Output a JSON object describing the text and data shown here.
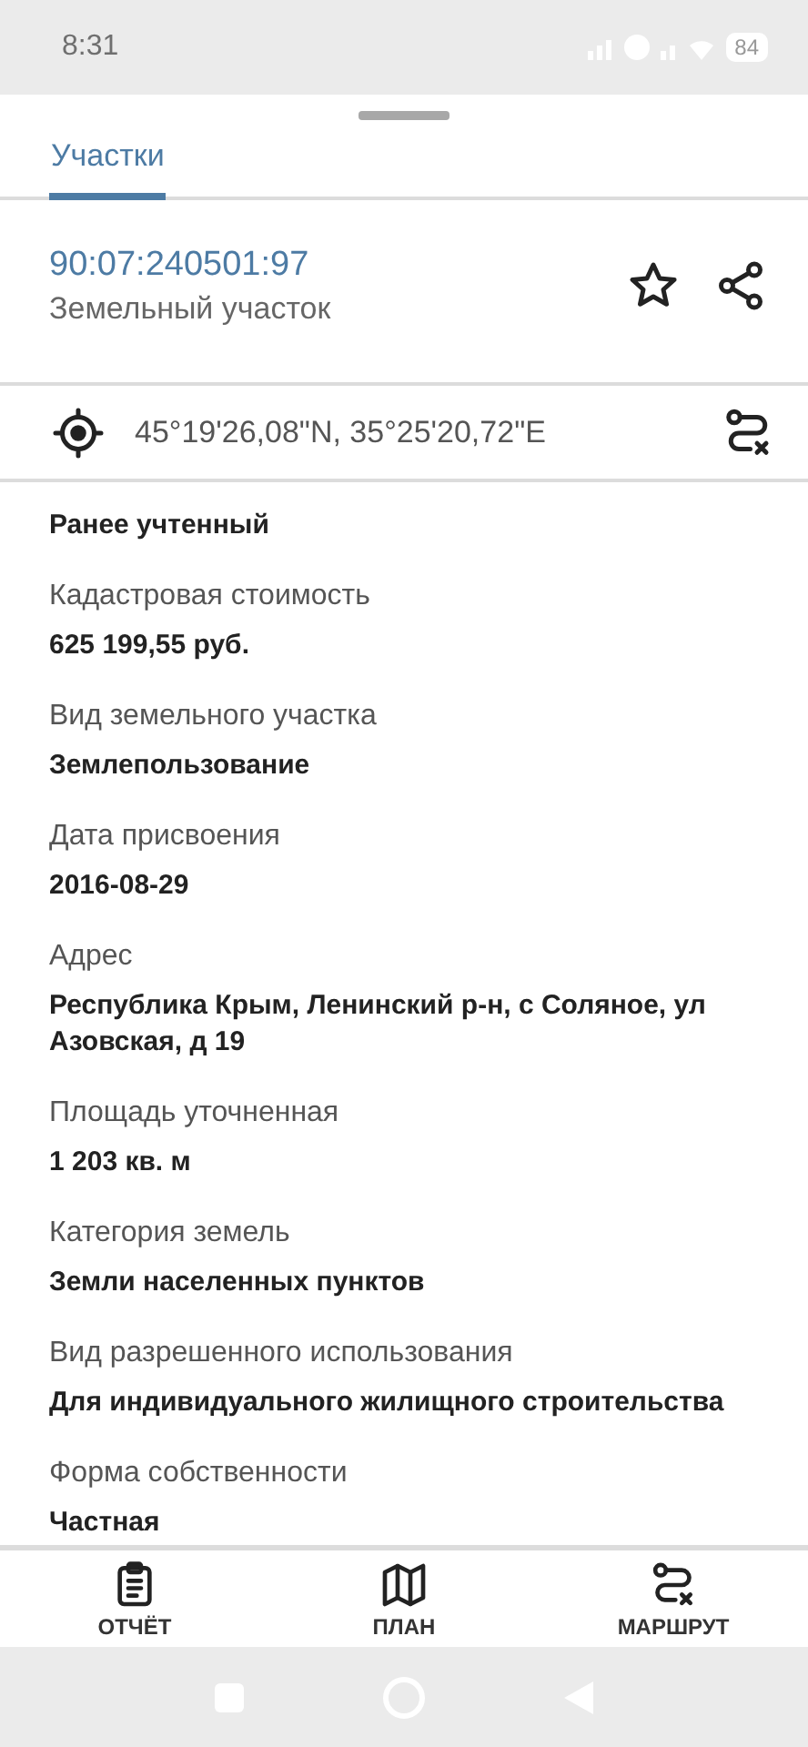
{
  "status_bar": {
    "time": "8:31",
    "battery": "84"
  },
  "tabs": [
    {
      "label": "Участки",
      "selected": true
    }
  ],
  "parcel": {
    "number": "90:07:240501:97",
    "type": "Земельный участок",
    "starred": false
  },
  "coordinates": "45°19'26,08\"N, 35°25'20,72\"E",
  "fields": [
    {
      "value": "Ранее учтенный"
    },
    {
      "label": "Кадастровая стоимость",
      "value": "625 199,55 руб."
    },
    {
      "label": "Вид земельного участка",
      "value": "Землепользование"
    },
    {
      "label": "Дата присвоения",
      "value": "2016-08-29"
    },
    {
      "label": "Адрес",
      "value": "Республика Крым, Ленинский р-н, с Соляное, ул Азовская, д 19"
    },
    {
      "label": "Площадь уточненная",
      "value": "1 203 кв. м"
    },
    {
      "label": "Категория земель",
      "value": "Земли населенных пунктов"
    },
    {
      "label": "Вид разрешенного использования",
      "value": "Для индивидуального жилищного строительства"
    },
    {
      "label": "Форма собственности",
      "value": "Частная"
    }
  ],
  "bottom_nav": [
    {
      "kind": "report",
      "label": "ОТЧЁТ"
    },
    {
      "kind": "plan",
      "label": "ПЛАН"
    },
    {
      "kind": "route",
      "label": "МАРШРУТ"
    }
  ]
}
